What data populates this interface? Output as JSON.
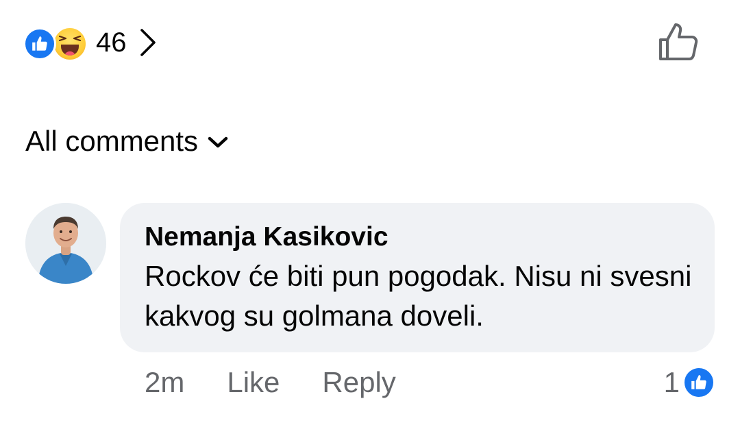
{
  "post_reactions": {
    "count": "46",
    "types": [
      "like-icon",
      "haha-icon"
    ],
    "like_color": "#1877f2"
  },
  "comments_filter": {
    "label": "All comments"
  },
  "comment": {
    "author": "Nemanja Kasikovic",
    "text": "Rockov će biti pun pogodak. Nisu ni svesni kakvog su golmana doveli.",
    "time": "2m",
    "like_label": "Like",
    "reply_label": "Reply",
    "reaction_count": "1",
    "bubble_color": "#f0f2f5"
  },
  "colors": {
    "accent": "#1877f2",
    "secondary_text": "#65676b",
    "primary_text": "#050505"
  }
}
